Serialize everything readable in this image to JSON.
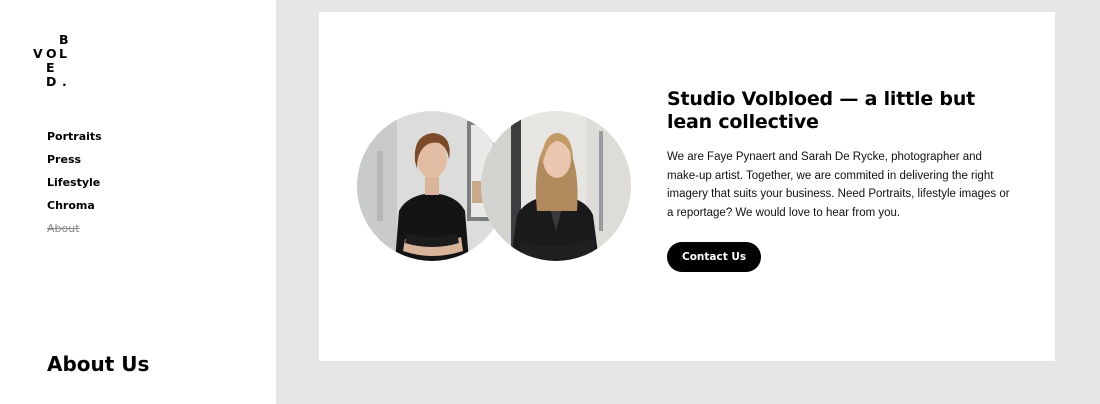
{
  "logo": {
    "letters": [
      "B",
      "V",
      "O",
      "L",
      "E",
      "D",
      "."
    ]
  },
  "nav": {
    "items": [
      {
        "label": "Portraits"
      },
      {
        "label": "Press"
      },
      {
        "label": "Lifestyle"
      },
      {
        "label": "Chroma"
      },
      {
        "label": "About"
      }
    ],
    "active": "About"
  },
  "page": {
    "heading": "About Us"
  },
  "studio": {
    "headline": "Studio Volbloed — a little but lean collective",
    "body": "We are Faye Pynaert and Sarah De Rycke, photographer and make-up artist. Together, we are commited in delivering the right imagery that suits your business. Need Portraits, lifestyle images or a reportage? We would love to hear from you.",
    "cta_label": "Contact Us"
  },
  "colors": {
    "background": "#e6e6e6",
    "sidebar": "#ffffff",
    "card": "#ffffff",
    "button": "#000000",
    "active_nav": "#8a8a8a"
  }
}
